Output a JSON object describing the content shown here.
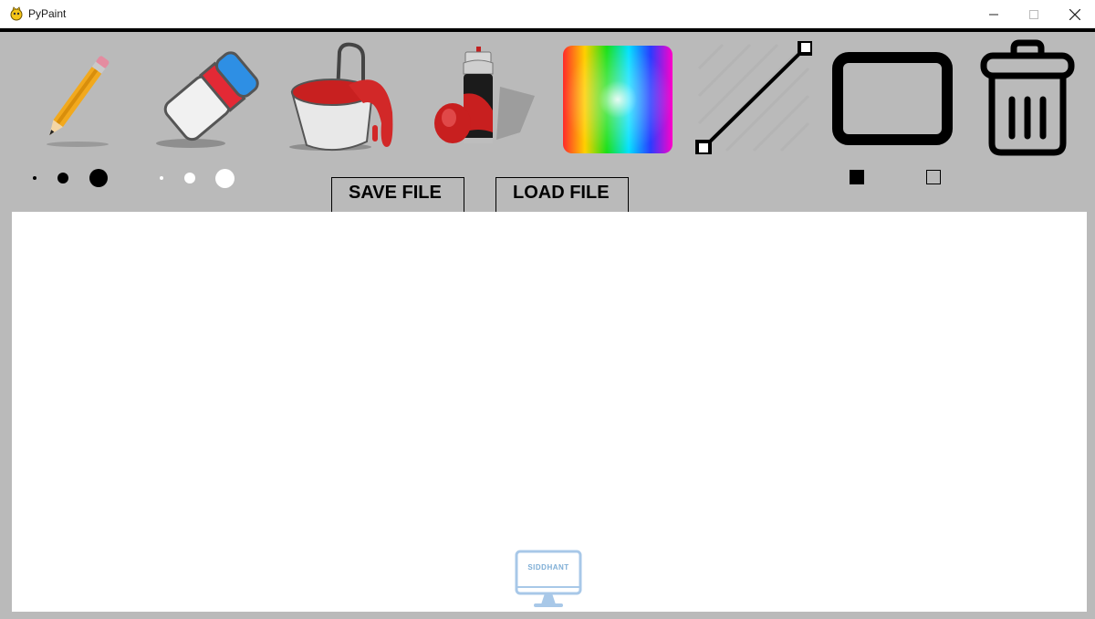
{
  "window": {
    "title": "PyPaint",
    "controls": [
      "minimize",
      "maximize",
      "close"
    ]
  },
  "toolbar": {
    "tools": [
      {
        "name": "pencil",
        "icon": "pencil-icon"
      },
      {
        "name": "eraser",
        "icon": "eraser-icon"
      },
      {
        "name": "fill",
        "icon": "paint-bucket-icon"
      },
      {
        "name": "spray",
        "icon": "spray-can-icon"
      },
      {
        "name": "color-picker",
        "icon": "color-wheel-icon"
      },
      {
        "name": "line",
        "icon": "line-icon"
      },
      {
        "name": "rectangle",
        "icon": "rectangle-icon"
      },
      {
        "name": "clear",
        "icon": "trash-icon"
      }
    ],
    "pencil_sizes": [
      "small",
      "medium",
      "large"
    ],
    "eraser_sizes": [
      "small",
      "medium",
      "large"
    ],
    "save_label": "SAVE FILE",
    "load_label": "LOAD FILE",
    "rect_modes": [
      "filled",
      "outline"
    ]
  },
  "watermark": {
    "text": "SIDDHANT"
  },
  "colors": {
    "toolbar_bg": "#bababa",
    "canvas_bg": "#ffffff",
    "border": "#000000"
  }
}
